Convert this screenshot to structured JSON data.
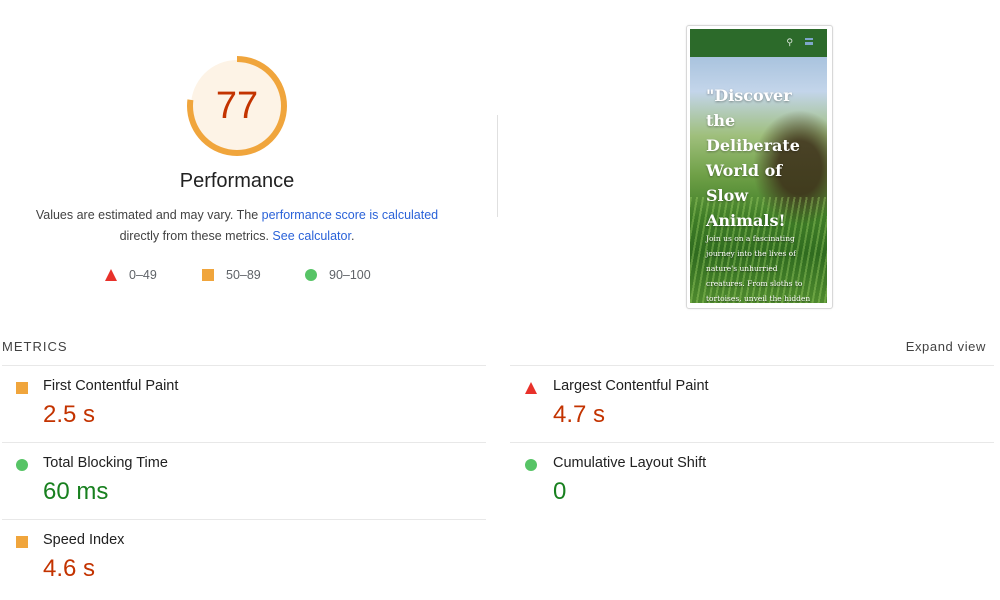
{
  "score": {
    "value": "77",
    "fraction": 0.77,
    "ring_color": "#f0a53c",
    "fill_color": "#fdf3e6",
    "text_color": "#c33300"
  },
  "performance": {
    "title": "Performance",
    "desc_text_1": "Values are estimated and may vary. The ",
    "desc_link_1": "performance score is calculated",
    "desc_text_2": "directly from these metrics. ",
    "desc_link_2": "See calculator",
    "desc_text_3": "."
  },
  "legend": [
    {
      "shape": "triangle",
      "color": "#e8312a",
      "label": "0–49"
    },
    {
      "shape": "square",
      "color": "#f0a53c",
      "label": "50–89"
    },
    {
      "shape": "circle",
      "color": "#57c466",
      "label": "90–100"
    }
  ],
  "screenshot": {
    "nav_color": "#2c6a2a",
    "search_icon": "search-icon",
    "menu_icon": "menu-icon",
    "headline": "\"Discover the Deliberate World of Slow Animals!",
    "body": "Join us on a fascinating journey into the lives of nature's unhurried creatures. From sloths to tortoises, unveil the hidden wonders of"
  },
  "metrics": {
    "title": "METRICS",
    "expand_label": "Expand view",
    "items": [
      {
        "label": "First Contentful Paint",
        "value": "2.5 s",
        "rating": "average",
        "icon": "square",
        "value_color": "#c33300"
      },
      {
        "label": "Largest Contentful Paint",
        "value": "4.7 s",
        "rating": "fail",
        "icon": "triangle",
        "value_color": "#c33300"
      },
      {
        "label": "Total Blocking Time",
        "value": "60 ms",
        "rating": "pass",
        "icon": "circle",
        "value_color": "#18801f"
      },
      {
        "label": "Cumulative Layout Shift",
        "value": "0",
        "rating": "pass",
        "icon": "circle",
        "value_color": "#18801f"
      },
      {
        "label": "Speed Index",
        "value": "4.6 s",
        "rating": "average",
        "icon": "square",
        "value_color": "#c33300"
      }
    ]
  }
}
